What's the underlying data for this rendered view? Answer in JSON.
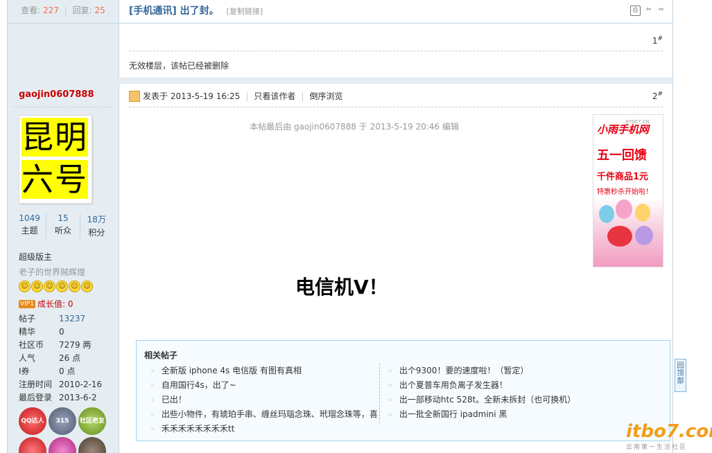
{
  "thread": {
    "views_label": "查看:",
    "views": "227",
    "replies_label": "回复:",
    "replies": "25",
    "title": "[手机通讯] 出了封。",
    "copy_link": "[复制链接]"
  },
  "icons": [
    "print-icon",
    "prev-thread-icon",
    "next-thread-icon"
  ],
  "floor1": {
    "number": "1",
    "mark": "#",
    "message": "无效楼层，该帖已经被删除"
  },
  "floor2": {
    "number": "2",
    "mark": "#",
    "posted": "发表于 2013-5-19 16:25",
    "only_author": "只看该作者",
    "reverse": "倒序浏览",
    "edited_note": "本帖最后由 gaojin0607888 于 2013-5-19 20:46 编辑",
    "body": "电信机V！"
  },
  "user": {
    "name": "gaojin0607888",
    "avatar_line1": "昆明",
    "avatar_line2": "六号",
    "stats": [
      {
        "value": "1049",
        "label": "主题"
      },
      {
        "value": "15",
        "label": "听众"
      },
      {
        "value": "18万",
        "label": "积分"
      }
    ],
    "rank": "超级版主",
    "motto": "老子的世界贼辉煌",
    "vip_badge": "VIP1",
    "growth": "成长值: 0",
    "props": [
      {
        "key": "帖子",
        "value": "13237"
      },
      {
        "key": "精华",
        "value": "0"
      },
      {
        "key": "社区币",
        "value": "7279 两"
      },
      {
        "key": "人气",
        "value": "26 点"
      },
      {
        "key": "I券",
        "value": "0 点"
      },
      {
        "key": "注册时间",
        "value": "2010-2-16"
      },
      {
        "key": "最后登录",
        "value": "2013-6-2"
      }
    ],
    "medals": [
      "QQ达人",
      "315",
      "社区老友"
    ]
  },
  "ad": {
    "logo": "小雨手机网",
    "logo_small": "XY007.CN",
    "line1": "五一回馈",
    "line2": "千件商品1元",
    "line3": "特惠秒杀开始啦！"
  },
  "related": {
    "title": "相关帖子",
    "left": [
      "全新版 iphone 4s 电信版 有图有真相",
      "自用国行4s，出了~",
      "已出！",
      "出些小物件，有琥珀手串、缠丝玛瑙念珠、玳瑁念珠等，喜",
      "禾禾禾禾禾禾禾禾tt"
    ],
    "right": [
      "出个9300！要的速度啦！（暂定）",
      "出个夏普车用负离子发生器！",
      "出一部移动htc 528t。全新未拆封（也可换机）",
      "出一批全新国行 ipadmini 黑"
    ]
  },
  "gotop": "回顶部",
  "watermark": {
    "text": "itbo7.com",
    "sub": "云南第一生活社区"
  }
}
